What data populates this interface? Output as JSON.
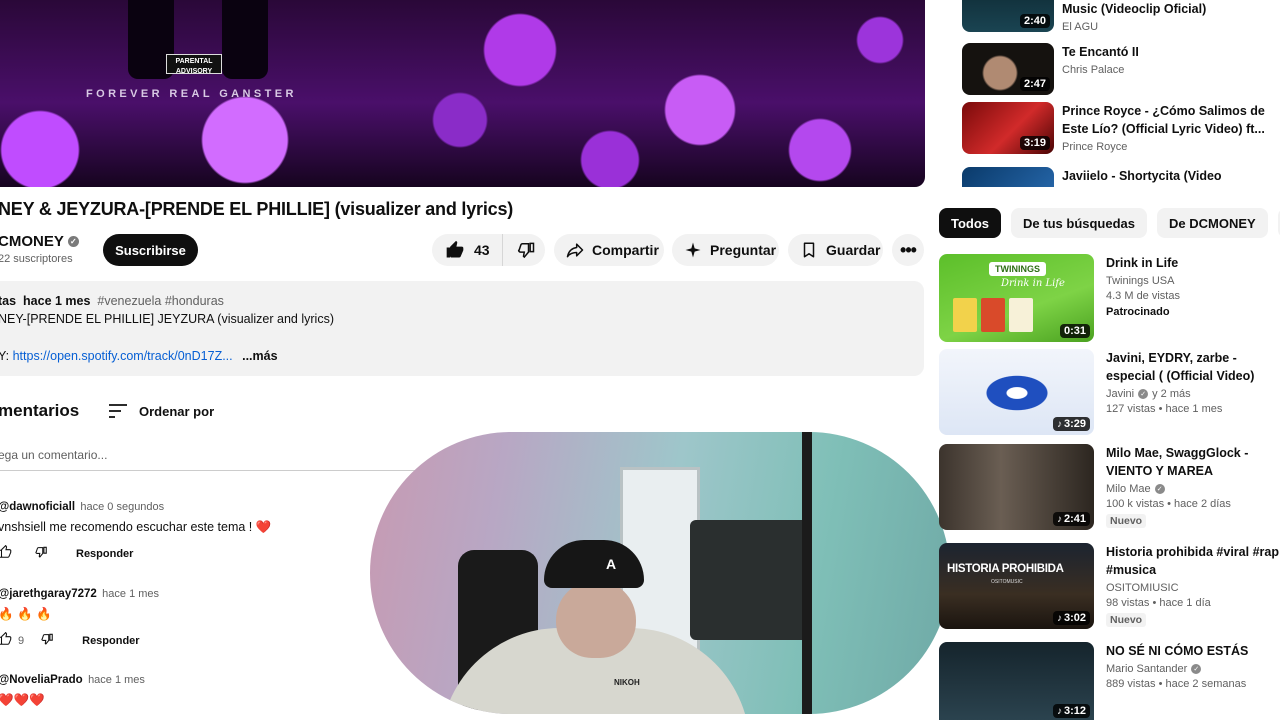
{
  "player": {
    "advisory": "PARENTAL ADVISORY",
    "overlay_text": "FOREVER REAL GANSTER"
  },
  "video": {
    "title": "NEY & JEYZURA-[PRENDE EL PHILLIE] (visualizer and lyrics)",
    "channel": "CMONEY",
    "subscribers": "22 suscriptores",
    "subscribe_label": "Suscribirse",
    "likes": "43",
    "share_label": "Compartir",
    "ask_label": "Preguntar",
    "save_label": "Guardar"
  },
  "description": {
    "views": "tas",
    "date": "hace 1 mes",
    "tags": "#venezuela #honduras",
    "line1": "NEY-[PRENDE EL PHILLIE] JEYZURA (visualizer and lyrics)",
    "line2_prefix": "Y:",
    "link": "https://open.spotify.com/track/0nD17Z...",
    "more": "...más"
  },
  "comments": {
    "title": "mentarios",
    "sort_label": "Ordenar por",
    "input_placeholder": "ega un comentario...",
    "reply_label": "Responder",
    "items": [
      {
        "author": "@dawnoficiall",
        "time": "hace 0 segundos",
        "text": "vnshsiell me recomendo escuchar este tema !",
        "emoji": "❤️",
        "likes": ""
      },
      {
        "author": "@jarethgaray7272",
        "time": "hace 1 mes",
        "text": "",
        "emoji": "🔥 🔥 🔥",
        "likes": "9"
      },
      {
        "author": "@NoveliaPrado",
        "time": "hace 1 mes",
        "text": "",
        "emoji": "❤️❤️❤️",
        "likes": ""
      }
    ]
  },
  "webcam": {
    "cap_logo": "A",
    "hoodie_text": "NIKOH"
  },
  "sidebar_top": [
    {
      "title": "Music (Videoclip Oficial)",
      "channel": "El AGU",
      "duration": "2:40"
    },
    {
      "title": "Te Encantó II",
      "channel": "Chris Palace",
      "duration": "2:47"
    },
    {
      "title": "Prince Royce - ¿Cómo Salimos de Este Lío? (Official Lyric Video) ft...",
      "channel": "Prince Royce",
      "duration": "3:19"
    },
    {
      "title": "Javiielo - Shortycita (Video",
      "channel": "",
      "duration": ""
    }
  ],
  "chips": [
    "Todos",
    "De tus búsquedas",
    "De DCMONEY"
  ],
  "sidebar": [
    {
      "title": "Drink in Life",
      "channel": "Twinings USA",
      "meta": "4.3 M de vistas",
      "extra": "Patrocinado",
      "duration": "0:31",
      "brand": "TWININGS",
      "script": "Drink in Life"
    },
    {
      "title": "Javini, EYDRY, zarbe - especial ( (Official Video)",
      "channel": "Javini",
      "channel_suffix": "y 2 más",
      "meta": "127 vistas • hace 1 mes",
      "duration": "3:29"
    },
    {
      "title": "Milo Mae, SwaggGlock - VIENTO Y MAREA",
      "channel": "Milo Mae",
      "meta": "100 k vistas • hace 2 días",
      "badge": "Nuevo",
      "duration": "2:41"
    },
    {
      "title": "Historia prohibida #viral #rap #musica",
      "channel": "OSITOMIUSIC",
      "meta": "98 vistas • hace 1 día",
      "badge": "Nuevo",
      "duration": "3:02",
      "thumb_title": "HISTORIA PROHIBIDA",
      "thumb_sub": "OSITOMUSIC"
    },
    {
      "title": "NO SÉ NI CÓMO ESTÁS",
      "channel": "Mario Santander",
      "meta": "889 vistas • hace 2 semanas",
      "duration": "3:12"
    }
  ]
}
